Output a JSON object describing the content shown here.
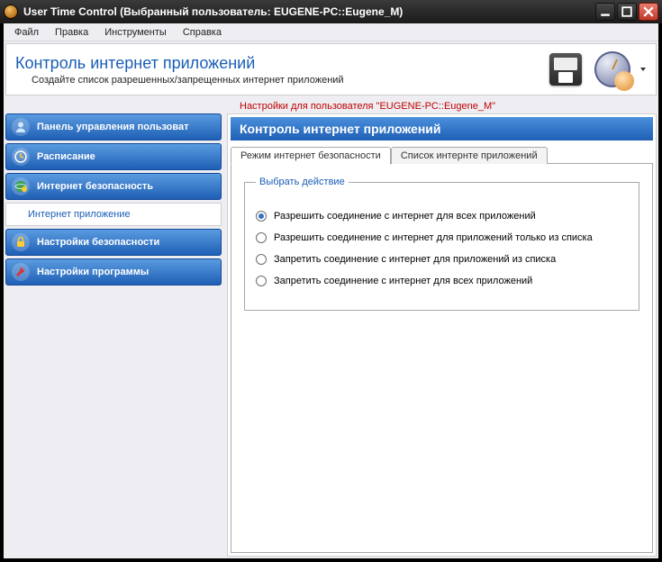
{
  "window": {
    "title": "User Time Control (Выбранный пользователь: EUGENE-PC::Eugene_M)"
  },
  "menubar": [
    "Файл",
    "Правка",
    "Инструменты",
    "Справка"
  ],
  "header": {
    "title": "Контроль интернет приложений",
    "subtitle": "Создайте список разрешенных/запрещенных интернет приложений"
  },
  "settings_for": "Настройки для пользователя \"EUGENE-PC::Eugene_M\"",
  "sidebar": {
    "items": [
      {
        "label": "Панель управления пользоват",
        "icon": "user"
      },
      {
        "label": "Расписание",
        "icon": "clock"
      },
      {
        "label": "Интернет безопасность",
        "icon": "globe"
      },
      {
        "label": "Настройки безопасности",
        "icon": "lock"
      },
      {
        "label": "Настройки программы",
        "icon": "tool"
      }
    ],
    "sub_item": "Интернет приложение"
  },
  "content": {
    "title": "Контроль интернет приложений",
    "tabs": [
      {
        "label": "Режим интернет безопасности",
        "active": true
      },
      {
        "label": "Список интернте приложений",
        "active": false
      }
    ],
    "group_legend": "Выбрать действие",
    "radios": [
      {
        "label": "Разрешить соединение с интернет для всех приложений",
        "checked": true
      },
      {
        "label": "Разрешить соединение с интернет для приложений только из списка",
        "checked": false
      },
      {
        "label": "Запретить соединение с интернет для приложений из списка",
        "checked": false
      },
      {
        "label": "Запретить соединение с интернет для всех приложений",
        "checked": false
      }
    ]
  },
  "colors": {
    "accent": "#1f5fb5",
    "link": "#1a5eb6",
    "red": "#c00000"
  }
}
